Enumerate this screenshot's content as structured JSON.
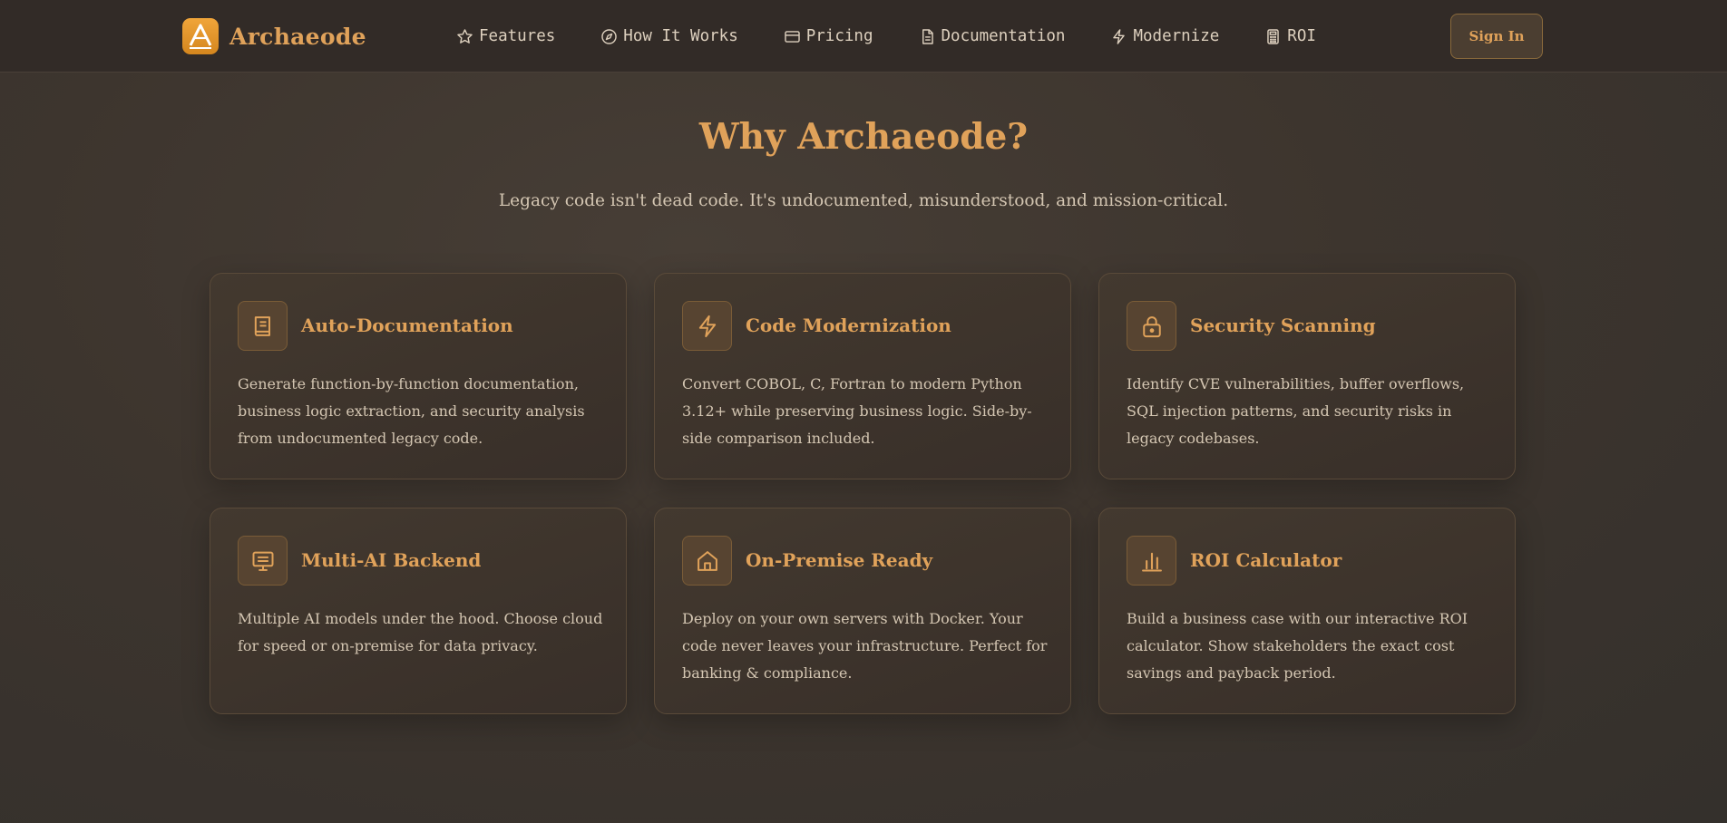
{
  "brand": {
    "name": "Archaeode"
  },
  "nav": {
    "links": [
      {
        "label": "Features",
        "icon": "star-icon"
      },
      {
        "label": "How It Works",
        "icon": "compass-icon"
      },
      {
        "label": "Pricing",
        "icon": "credit-card-icon"
      },
      {
        "label": "Documentation",
        "icon": "document-icon"
      },
      {
        "label": "Modernize",
        "icon": "lightning-icon"
      },
      {
        "label": "ROI",
        "icon": "calculator-icon"
      }
    ],
    "signin_label": "Sign In"
  },
  "hero": {
    "title": "Why Archaeode?",
    "subtitle": "Legacy code isn't dead code. It's undocumented, misunderstood, and mission-critical."
  },
  "features": [
    {
      "title": "Auto-Documentation",
      "description": "Generate function-by-function documentation, business logic extraction, and security analysis from undocumented legacy code.",
      "icon": "book-icon"
    },
    {
      "title": "Code Modernization",
      "description": "Convert COBOL, C, Fortran to modern Python 3.12+ while preserving business logic. Side-by-side comparison included.",
      "icon": "lightning-icon"
    },
    {
      "title": "Security Scanning",
      "description": "Identify CVE vulnerabilities, buffer overflows, SQL injection patterns, and security risks in legacy codebases.",
      "icon": "lock-icon"
    },
    {
      "title": "Multi-AI Backend",
      "description": "Multiple AI models under the hood. Choose cloud for speed or on-premise for data privacy.",
      "icon": "monitor-icon"
    },
    {
      "title": "On-Premise Ready",
      "description": "Deploy on your own servers with Docker. Your code never leaves your infrastructure. Perfect for banking & compliance.",
      "icon": "home-icon"
    },
    {
      "title": "ROI Calculator",
      "description": "Build a business case with our interactive ROI calculator. Show stakeholders the exact cost savings and payback period.",
      "icon": "bar-chart-icon"
    }
  ],
  "colors": {
    "accent": "#e0a25a",
    "background": "#3d352e",
    "nav_background": "#322b27",
    "card_border": "#5a4a39",
    "body_text": "#d4c6b2"
  }
}
